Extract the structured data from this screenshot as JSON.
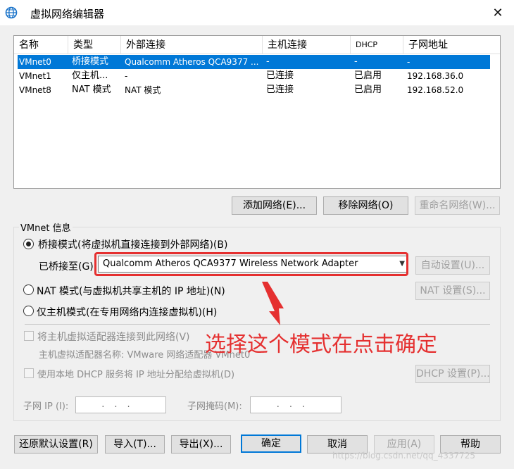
{
  "window": {
    "title": "虚拟网络编辑器",
    "close_symbol": "✕"
  },
  "table": {
    "columns": [
      "名称",
      "类型",
      "外部连接",
      "主机连接",
      "DHCP",
      "子网地址"
    ],
    "rows": [
      {
        "name": "VMnet0",
        "type": "桥接模式",
        "external": "Qualcomm Atheros QCA9377 ...",
        "host": "-",
        "dhcp": "-",
        "subnet": "-",
        "selected": true
      },
      {
        "name": "VMnet1",
        "type": "仅主机...",
        "external": "-",
        "host": "已连接",
        "dhcp": "已启用",
        "subnet": "192.168.36.0",
        "selected": false
      },
      {
        "name": "VMnet8",
        "type": "NAT 模式",
        "external": "NAT 模式",
        "host": "已连接",
        "dhcp": "已启用",
        "subnet": "192.168.52.0",
        "selected": false
      }
    ]
  },
  "network_buttons": {
    "add": "添加网络(E)...",
    "remove": "移除网络(O)",
    "rename": "重命名网络(W)..."
  },
  "vmnet_info": {
    "label": "VMnet 信息",
    "bridged_label": "桥接模式(将虚拟机直接连接到外部网络)(B)",
    "bridged_to_label": "已桥接至(G)",
    "bridged_to_value": "Qualcomm Atheros QCA9377 Wireless Network Adapter",
    "auto_settings": "自动设置(U)...",
    "nat_label": "NAT 模式(与虚拟机共享主机的 IP 地址)(N)",
    "nat_settings": "NAT 设置(S)...",
    "hostonly_label": "仅主机模式(在专用网络内连接虚拟机)(H)",
    "connect_adapter_label": "将主机虚拟适配器连接到此网络(V)",
    "adapter_name_label": "主机虚拟适配器名称: VMware 网络适配器 VMnet0",
    "dhcp_label": "使用本地 DHCP 服务将 IP 地址分配给虚拟机(D)",
    "dhcp_settings": "DHCP 设置(P)...",
    "subnet_ip_label": "子网 IP (I):",
    "subnet_mask_label": "子网掩码(M):",
    "ip_placeholder": "...",
    "selected_mode": "bridged"
  },
  "footer_buttons": {
    "restore": "还原默认设置(R)",
    "import": "导入(T)...",
    "export": "导出(X)...",
    "ok": "确定",
    "cancel": "取消",
    "apply": "应用(A)",
    "help": "帮助"
  },
  "annotation": {
    "text": "选择这个模式在点击确定",
    "color": "#e53030"
  },
  "watermark": "https://blog.csdn.net/qq_4337725",
  "colors": {
    "selection": "#0078d7",
    "annotation": "#e53030",
    "background": "#f0f0f0"
  }
}
